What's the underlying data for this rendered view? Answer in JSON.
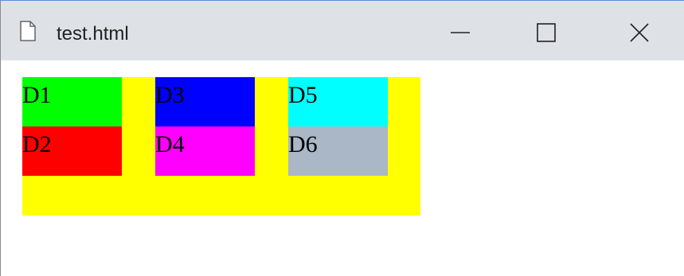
{
  "window": {
    "title": "test.html",
    "controls": {
      "minimize": "minimize-icon",
      "maximize": "maximize-icon",
      "close": "close-icon"
    }
  },
  "page": {
    "container_color": "#ffff00",
    "boxes": [
      {
        "label": "D1",
        "color": "#00ff00"
      },
      {
        "label": "D2",
        "color": "#ff0000"
      },
      {
        "label": "D3",
        "color": "#0000ff"
      },
      {
        "label": "D4",
        "color": "#ff00ff"
      },
      {
        "label": "D5",
        "color": "#00ffff"
      },
      {
        "label": "D6",
        "color": "#a9b7c6"
      }
    ]
  }
}
